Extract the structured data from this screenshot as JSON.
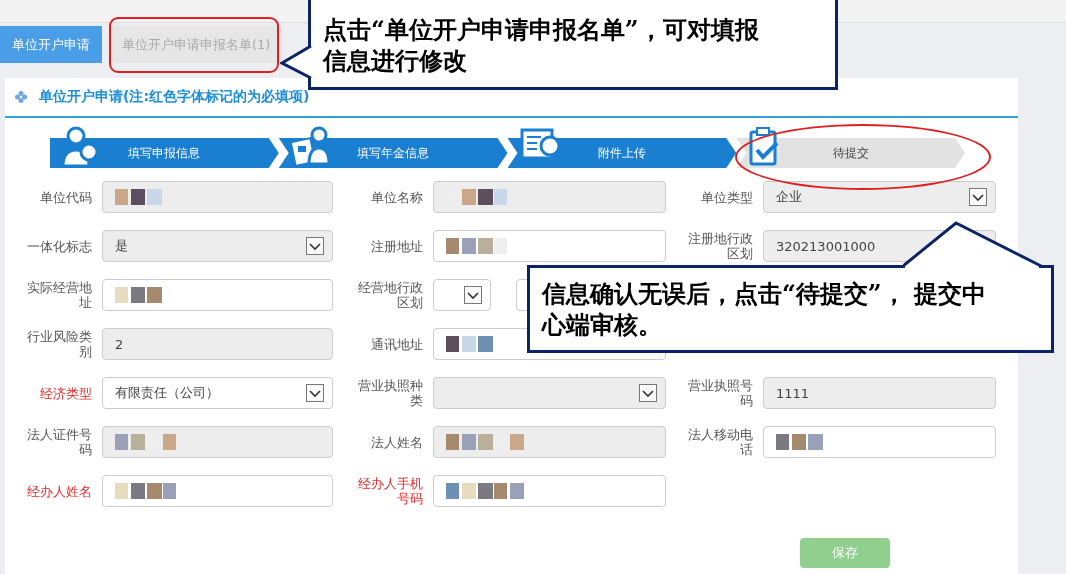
{
  "tabs": [
    {
      "label": "单位开户申请",
      "selected": true
    },
    {
      "label": "单位开户申请申报名单(1)",
      "selected": false
    }
  ],
  "panel": {
    "title": "单位开户申请(注:红色字体标记的为必填项)"
  },
  "steps": [
    {
      "label": "填写申报信息",
      "kind": "person-search",
      "done": true
    },
    {
      "label": "填写年金信息",
      "kind": "id-card",
      "done": true
    },
    {
      "label": "附件上传",
      "kind": "doc-search",
      "done": true
    },
    {
      "label": "待提交",
      "kind": "clipboard",
      "done": false
    }
  ],
  "form": {
    "rows": [
      [
        {
          "label": "单位代码",
          "required": false,
          "kind": "text",
          "readonly": true,
          "redacted": true
        },
        {
          "label": "单位名称",
          "required": false,
          "kind": "text",
          "readonly": true,
          "redacted": true
        },
        {
          "label": "单位类型",
          "required": false,
          "kind": "select",
          "readonly": true,
          "redacted": false,
          "value": "企业"
        }
      ],
      [
        {
          "label": "一体化标志",
          "required": false,
          "kind": "select",
          "readonly": true,
          "redacted": false,
          "value": "是"
        },
        {
          "label": "注册地址",
          "required": false,
          "kind": "text",
          "readonly": false,
          "redacted": true
        },
        {
          "label": "注册地行政区划",
          "required": false,
          "kind": "text",
          "readonly": true,
          "redacted": false,
          "value": "320213001000"
        }
      ],
      [
        {
          "label": "实际经营地址",
          "required": false,
          "kind": "text",
          "readonly": false,
          "redacted": true
        },
        {
          "label": "经营地行政区划",
          "required": false,
          "kind": "region",
          "readonly": false,
          "redacted": false
        }
      ],
      [
        {
          "label": "行业风险类别",
          "required": false,
          "kind": "text",
          "readonly": true,
          "redacted": false,
          "value": "2"
        },
        {
          "label": "通讯地址",
          "required": false,
          "kind": "text",
          "readonly": false,
          "redacted": true
        }
      ],
      [
        {
          "label": "经济类型",
          "required": true,
          "kind": "select",
          "readonly": false,
          "redacted": false,
          "value": "有限责任（公司）"
        },
        {
          "label": "营业执照种类",
          "required": false,
          "kind": "select",
          "readonly": true,
          "redacted": false
        },
        {
          "label": "营业执照号码",
          "required": false,
          "kind": "text",
          "readonly": true,
          "redacted": false,
          "value": "1111"
        }
      ],
      [
        {
          "label": "法人证件号码",
          "required": false,
          "kind": "text",
          "readonly": true,
          "redacted": true
        },
        {
          "label": "法人姓名",
          "required": false,
          "kind": "text",
          "readonly": true,
          "redacted": true
        },
        {
          "label": "法人移动电话",
          "required": false,
          "kind": "text",
          "readonly": false,
          "redacted": true
        }
      ],
      [
        {
          "label": "经办人姓名",
          "required": true,
          "kind": "text",
          "readonly": false,
          "redacted": true
        },
        {
          "label": "经办人手机号码",
          "required": true,
          "kind": "text",
          "readonly": false,
          "redacted": true
        }
      ]
    ]
  },
  "save_button": {
    "label": "保存"
  },
  "callouts": [
    {
      "text": "点击“单位开户申请申报名单”，可对填报信息进行修改",
      "kind": "left"
    },
    {
      "text": "信息确认无误后，点击“待提交”， 提交中心端审核。",
      "kind": "up"
    }
  ]
}
